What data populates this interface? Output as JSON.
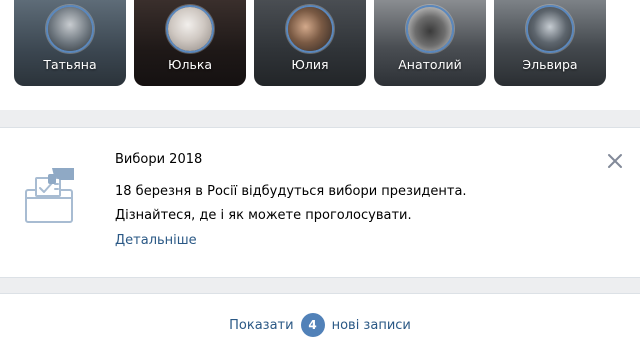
{
  "stories": [
    {
      "name": "Татьяна"
    },
    {
      "name": "Юлька"
    },
    {
      "name": "Юлия"
    },
    {
      "name": "Анатолий"
    },
    {
      "name": "Эльвира"
    }
  ],
  "notice": {
    "title": "Вибори 2018",
    "text_line1": "18 березня в Росії відбудуться вибори президента.",
    "text_line2": "Дізнайтеся, де і як можете проголосувати.",
    "more_link": "Детальніше",
    "close_icon": "close-icon",
    "illustration_icon": "ballot-box-icon"
  },
  "feed": {
    "show_prefix": "Показати",
    "new_count": "4",
    "show_suffix": "нові записи"
  },
  "colors": {
    "accent": "#5181b8",
    "link": "#2a5885",
    "ring": "#5b88bd",
    "page_bg": "#edeef0"
  }
}
